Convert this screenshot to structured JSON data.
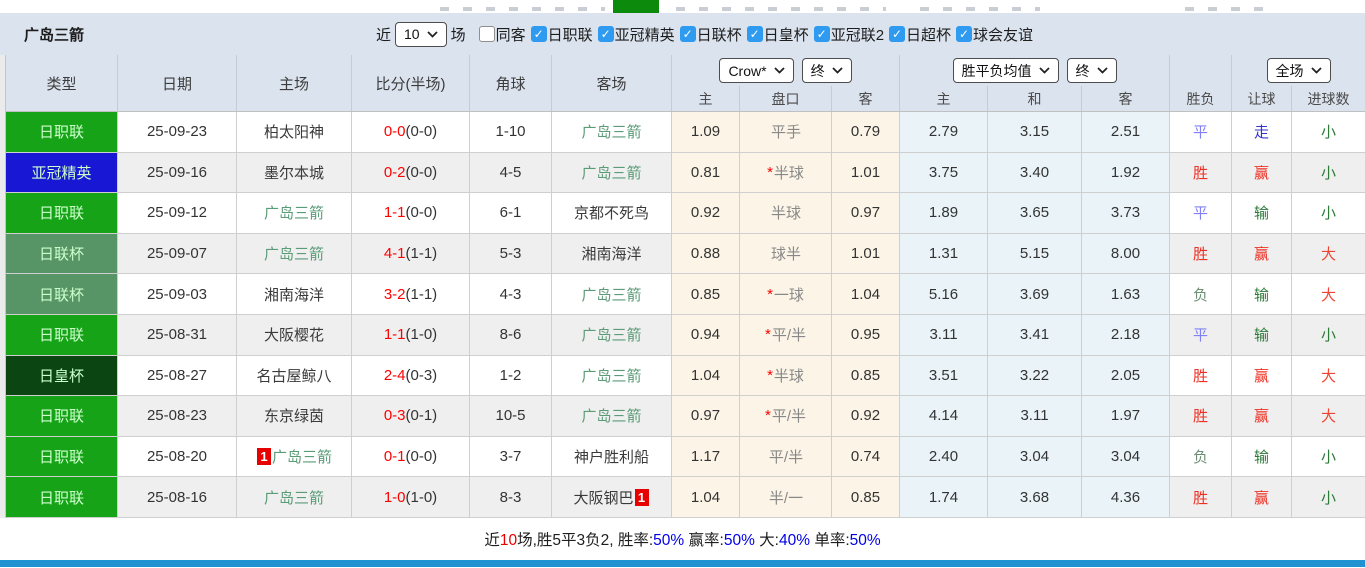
{
  "page": {
    "team_title": "广岛三箭"
  },
  "filters": {
    "recent_label": "近",
    "recent_value": "10",
    "matches_label": "场",
    "same_venue": {
      "label": "同客",
      "checked": false
    },
    "competitions": [
      {
        "label": "日职联",
        "checked": true
      },
      {
        "label": "亚冠精英",
        "checked": true
      },
      {
        "label": "日联杯",
        "checked": true
      },
      {
        "label": "日皇杯",
        "checked": true
      },
      {
        "label": "亚冠联2",
        "checked": true
      },
      {
        "label": "日超杯",
        "checked": true
      },
      {
        "label": "球会友谊",
        "checked": true
      }
    ]
  },
  "table": {
    "headers": {
      "type": "类型",
      "date": "日期",
      "home": "主场",
      "score": "比分(半场)",
      "corners": "角球",
      "away": "客场"
    },
    "dropdowns": {
      "odds_company": "Crow*",
      "ah_time": "终",
      "europe_source": "胜平负均值",
      "eu_time": "终",
      "scope": "全场"
    },
    "sub_headers": [
      "主",
      "盘口",
      "客",
      "主",
      "和",
      "客",
      "胜负",
      "让球",
      "进球数"
    ],
    "type_colors": {
      "日职联": "#17a317",
      "亚冠精英": "#1717d4",
      "日联杯": "#579466",
      "日皇杯": "#0a4512"
    },
    "result_colors": {
      "胜": "red",
      "赢": "red",
      "大": "red_light",
      "平": "draw_blue",
      "走": "strong_blue",
      "负": "gray_green",
      "输": "green",
      "小": "green"
    },
    "rows": [
      {
        "type": "日职联",
        "date": "25-09-23",
        "home": "柏太阳神",
        "home_rank": "",
        "score_ft": "0-0",
        "score_ht": "(0-0)",
        "corners": "1-10",
        "away": "广岛三箭",
        "away_rank": "",
        "ah_home": "1.09",
        "star": "",
        "handicap": "平手",
        "ah_away": "0.79",
        "eu_home": "2.79",
        "eu_draw": "3.15",
        "eu_away": "2.51",
        "wdl": "平",
        "ah_result": "走",
        "ou_result": "小"
      },
      {
        "type": "亚冠精英",
        "date": "25-09-16",
        "home": "墨尔本城",
        "home_rank": "",
        "score_ft": "0-2",
        "score_ht": "(0-0)",
        "corners": "4-5",
        "away": "广岛三箭",
        "away_rank": "",
        "ah_home": "0.81",
        "star": "*",
        "handicap": "半球",
        "ah_away": "1.01",
        "eu_home": "3.75",
        "eu_draw": "3.40",
        "eu_away": "1.92",
        "wdl": "胜",
        "ah_result": "赢",
        "ou_result": "小"
      },
      {
        "type": "日职联",
        "date": "25-09-12",
        "home": "广岛三箭",
        "home_rank": "",
        "score_ft": "1-1",
        "score_ht": "(0-0)",
        "corners": "6-1",
        "away": "京都不死鸟",
        "away_rank": "",
        "ah_home": "0.92",
        "star": "",
        "handicap": "半球",
        "ah_away": "0.97",
        "eu_home": "1.89",
        "eu_draw": "3.65",
        "eu_away": "3.73",
        "wdl": "平",
        "ah_result": "输",
        "ou_result": "小"
      },
      {
        "type": "日联杯",
        "date": "25-09-07",
        "home": "广岛三箭",
        "home_rank": "",
        "score_ft": "4-1",
        "score_ht": "(1-1)",
        "corners": "5-3",
        "away": "湘南海洋",
        "away_rank": "",
        "ah_home": "0.88",
        "star": "",
        "handicap": "球半",
        "ah_away": "1.01",
        "eu_home": "1.31",
        "eu_draw": "5.15",
        "eu_away": "8.00",
        "wdl": "胜",
        "ah_result": "赢",
        "ou_result": "大"
      },
      {
        "type": "日联杯",
        "date": "25-09-03",
        "home": "湘南海洋",
        "home_rank": "",
        "score_ft": "3-2",
        "score_ht": "(1-1)",
        "corners": "4-3",
        "away": "广岛三箭",
        "away_rank": "",
        "ah_home": "0.85",
        "star": "*",
        "handicap": "一球",
        "ah_away": "1.04",
        "eu_home": "5.16",
        "eu_draw": "3.69",
        "eu_away": "1.63",
        "wdl": "负",
        "ah_result": "输",
        "ou_result": "大"
      },
      {
        "type": "日职联",
        "date": "25-08-31",
        "home": "大阪樱花",
        "home_rank": "",
        "score_ft": "1-1",
        "score_ht": "(1-0)",
        "corners": "8-6",
        "away": "广岛三箭",
        "away_rank": "",
        "ah_home": "0.94",
        "star": "*",
        "handicap": "平/半",
        "ah_away": "0.95",
        "eu_home": "3.11",
        "eu_draw": "3.41",
        "eu_away": "2.18",
        "wdl": "平",
        "ah_result": "输",
        "ou_result": "小"
      },
      {
        "type": "日皇杯",
        "date": "25-08-27",
        "home": "名古屋鲸八",
        "home_rank": "",
        "score_ft": "2-4",
        "score_ht": "(0-3)",
        "corners": "1-2",
        "away": "广岛三箭",
        "away_rank": "",
        "ah_home": "1.04",
        "star": "*",
        "handicap": "半球",
        "ah_away": "0.85",
        "eu_home": "3.51",
        "eu_draw": "3.22",
        "eu_away": "2.05",
        "wdl": "胜",
        "ah_result": "赢",
        "ou_result": "大"
      },
      {
        "type": "日职联",
        "date": "25-08-23",
        "home": "东京绿茵",
        "home_rank": "",
        "score_ft": "0-3",
        "score_ht": "(0-1)",
        "corners": "10-5",
        "away": "广岛三箭",
        "away_rank": "",
        "ah_home": "0.97",
        "star": "*",
        "handicap": "平/半",
        "ah_away": "0.92",
        "eu_home": "4.14",
        "eu_draw": "3.11",
        "eu_away": "1.97",
        "wdl": "胜",
        "ah_result": "赢",
        "ou_result": "大"
      },
      {
        "type": "日职联",
        "date": "25-08-20",
        "home": "广岛三箭",
        "home_rank": "1",
        "score_ft": "0-1",
        "score_ht": "(0-0)",
        "corners": "3-7",
        "away": "神户胜利船",
        "away_rank": "",
        "ah_home": "1.17",
        "star": "",
        "handicap": "平/半",
        "ah_away": "0.74",
        "eu_home": "2.40",
        "eu_draw": "3.04",
        "eu_away": "3.04",
        "wdl": "负",
        "ah_result": "输",
        "ou_result": "小"
      },
      {
        "type": "日职联",
        "date": "25-08-16",
        "home": "广岛三箭",
        "home_rank": "",
        "score_ft": "1-0",
        "score_ht": "(1-0)",
        "corners": "8-3",
        "away": "大阪钢巴",
        "away_rank": "1",
        "ah_home": "1.04",
        "star": "",
        "handicap": "半/一",
        "ah_away": "0.85",
        "eu_home": "1.74",
        "eu_draw": "3.68",
        "eu_away": "4.36",
        "wdl": "胜",
        "ah_result": "赢",
        "ou_result": "小"
      }
    ]
  },
  "summary": {
    "text": "近10场,胜5平3负2, 胜率:50% 赢率:50% 大:40% 单率:50%",
    "parts": [
      {
        "t": "近"
      },
      {
        "t": "10",
        "c": "red"
      },
      {
        "t": "场,胜5平3负2, "
      },
      {
        "t": "胜率:"
      },
      {
        "t": "50%",
        "c": "blue"
      },
      {
        "t": " 赢率:"
      },
      {
        "t": "50%",
        "c": "blue"
      },
      {
        "t": " 大:"
      },
      {
        "t": "40%",
        "c": "blue"
      },
      {
        "t": " 单率:"
      },
      {
        "t": "50%",
        "c": "blue"
      }
    ]
  },
  "colors": {
    "header_bg": "#dbe3ee",
    "badge_green": "#17a317",
    "badge_blue": "#1717d4",
    "badge_muted_green": "#579466",
    "badge_dark_green": "#0a4512",
    "ah_col_bg": "#fcf5e7",
    "eu_col_bg": "#e9f3f8",
    "score_red": "#ff0000",
    "self_team_green": "#5b9c78",
    "bottom_bar_blue": "#1f93d1",
    "checkbox_blue": "#2e9af0"
  }
}
